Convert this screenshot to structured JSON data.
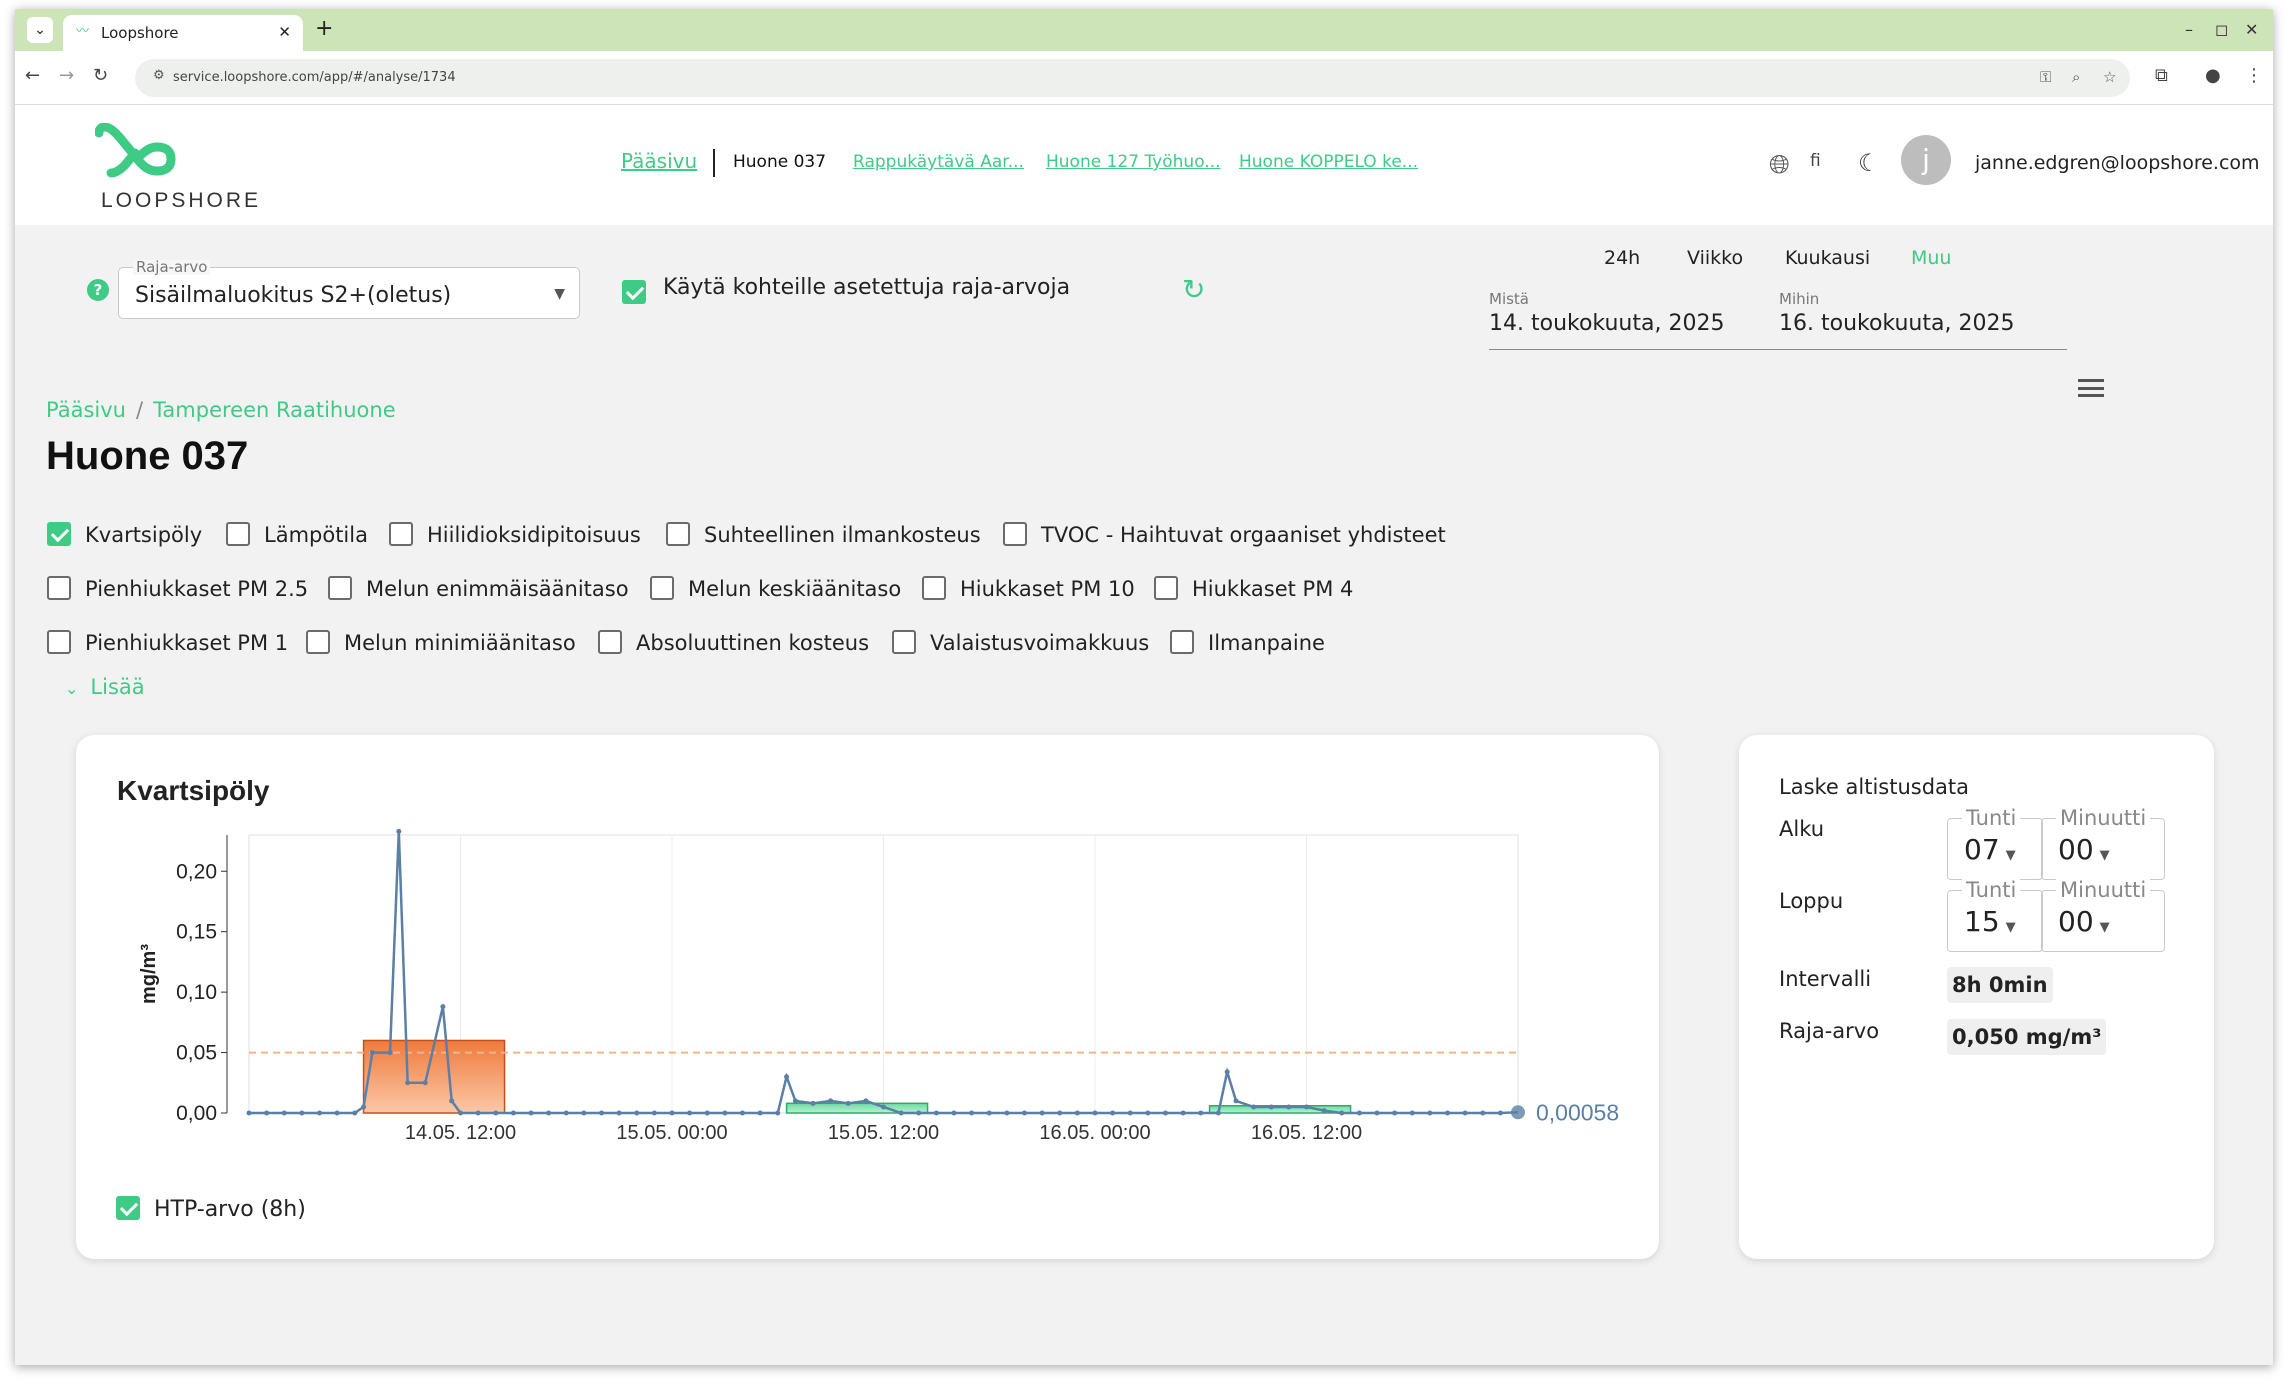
{
  "browser": {
    "tab_title": "Loopshore",
    "url": "service.loopshore.com/app/#/analyse/1734",
    "new_tab_label": "+"
  },
  "header": {
    "logo_text": "LOOPSHORE",
    "nav": [
      {
        "label": "Pääsivu"
      },
      {
        "label": "Huone 037"
      },
      {
        "label": "Rappukäytävä Aar..."
      },
      {
        "label": "Huone 127 Työhuo..."
      },
      {
        "label": "Huone KOPPELO ke..."
      }
    ],
    "language": "fi",
    "avatar_initial": "j",
    "user_email": "janne.edgren@loopshore.com"
  },
  "controls": {
    "limit_label": "Raja-arvo",
    "limit_value": "Sisäilmaluokitus S2+(oletus)",
    "use_target_limits_label": "Käytä kohteille asetettuja raja-arvoja",
    "periods": [
      "24h",
      "Viikko",
      "Kuukausi",
      "Muu"
    ],
    "active_period": "Muu",
    "from_label": "Mistä",
    "from_value": "14. toukokuuta, 2025",
    "to_label": "Mihin",
    "to_value": "16. toukokuuta, 2025"
  },
  "breadcrumb": {
    "home": "Pääsivu",
    "separator": "/",
    "site": "Tampereen Raatihuone"
  },
  "page_title": "Huone 037",
  "parameters": {
    "row1": [
      {
        "label": "Kvartsipöly",
        "checked": true
      },
      {
        "label": "Lämpötila",
        "checked": false
      },
      {
        "label": "Hiilidioksidipitoisuus",
        "checked": false
      },
      {
        "label": "Suhteellinen ilmankosteus",
        "checked": false
      },
      {
        "label": "TVOC - Haihtuvat orgaaniset yhdisteet",
        "checked": false
      }
    ],
    "row2": [
      {
        "label": "Pienhiukkaset PM 2.5",
        "checked": false
      },
      {
        "label": "Melun enimmäisäänitaso",
        "checked": false
      },
      {
        "label": "Melun keskiäänitaso",
        "checked": false
      },
      {
        "label": "Hiukkaset PM 10",
        "checked": false
      },
      {
        "label": "Hiukkaset PM 4",
        "checked": false
      }
    ],
    "row3": [
      {
        "label": "Pienhiukkaset PM 1",
        "checked": false
      },
      {
        "label": "Melun minimiäänitaso",
        "checked": false
      },
      {
        "label": "Absoluuttinen kosteus",
        "checked": false
      },
      {
        "label": "Valaistusvoimakkuus",
        "checked": false
      },
      {
        "label": "Ilmanpaine",
        "checked": false
      }
    ],
    "more_label": "Lisää"
  },
  "chart": {
    "title": "Kvartsipöly",
    "legend_label": "HTP-arvo (8h)",
    "last_value_label": "0,00058"
  },
  "chart_data": {
    "type": "line",
    "title": "Kvartsipöly",
    "ylabel": "mg/m³",
    "xlabel": "",
    "ylim": [
      0,
      0.23
    ],
    "yticks": [
      "0,00",
      "0,05",
      "0,10",
      "0,15",
      "0,20"
    ],
    "ytick_values": [
      0,
      0.05,
      0.1,
      0.15,
      0.2
    ],
    "xlim": [
      "14.05. 00:00",
      "16.05. 24:00"
    ],
    "xticks": [
      "14.05. 12:00",
      "15.05. 00:00",
      "15.05. 12:00",
      "16.05. 00:00",
      "16.05. 12:00"
    ],
    "xtick_hours": [
      12,
      24,
      36,
      48,
      60
    ],
    "threshold": 0.05,
    "series": [
      {
        "x_hours": [
          0,
          1,
          2,
          3,
          4,
          5,
          6,
          6.5,
          7,
          8,
          8.5,
          9,
          10,
          11,
          11.5,
          12,
          13,
          14,
          15,
          16,
          17,
          18,
          19,
          20,
          21,
          22,
          23,
          24,
          25,
          26,
          27,
          28,
          29,
          30,
          30.5,
          31,
          32,
          33,
          34,
          35,
          36,
          37,
          38,
          39,
          40,
          41,
          42,
          43,
          44,
          45,
          46,
          47,
          48,
          49,
          50,
          51,
          52,
          53,
          54,
          55,
          55.5,
          56,
          57,
          58,
          59,
          60,
          61,
          62,
          63,
          64,
          65,
          66,
          67,
          68,
          69,
          70,
          71,
          72
        ],
        "values": [
          0,
          0,
          0,
          0,
          0,
          0,
          0,
          0.005,
          0.05,
          0.05,
          0.233,
          0.025,
          0.025,
          0.088,
          0.01,
          0,
          0,
          0,
          0,
          0,
          0,
          0,
          0,
          0,
          0,
          0,
          0,
          0,
          0,
          0,
          0,
          0,
          0,
          0,
          0.03,
          0.01,
          0.008,
          0.01,
          0.008,
          0.01,
          0.005,
          0,
          0,
          0,
          0,
          0,
          0,
          0,
          0,
          0,
          0,
          0,
          0,
          0,
          0,
          0,
          0,
          0,
          0,
          0,
          0.034,
          0.01,
          0.005,
          0.005,
          0.005,
          0.005,
          0.002,
          0,
          0,
          0,
          0,
          0,
          0,
          0,
          0,
          0,
          0,
          0.00058
        ]
      }
    ],
    "htp_bars": [
      {
        "start_hour": 6.5,
        "end_hour": 14.5,
        "value": 0.06,
        "status": "above"
      },
      {
        "start_hour": 30.5,
        "end_hour": 38.5,
        "value": 0.008,
        "status": "below"
      },
      {
        "start_hour": 54.5,
        "end_hour": 62.5,
        "value": 0.006,
        "status": "below"
      }
    ],
    "grid": true,
    "legend": "bottom-left"
  },
  "exposure": {
    "title": "Laske altistusdata",
    "start_label": "Alku",
    "end_label": "Loppu",
    "hour_label": "Tunti",
    "minute_label": "Minuutti",
    "start_hour": "07",
    "start_minute": "00",
    "end_hour": "15",
    "end_minute": "00",
    "interval_label": "Intervalli",
    "interval_value": "8h 0min",
    "limit_label": "Raja-arvo",
    "limit_value": "0,050 mg/m³"
  },
  "colors": {
    "accent": "#3ecb85",
    "series": "#5b7fa6",
    "above_limit": "#f07a3c",
    "below_limit": "#7fe0ad",
    "threshold": "#f2b48c"
  }
}
